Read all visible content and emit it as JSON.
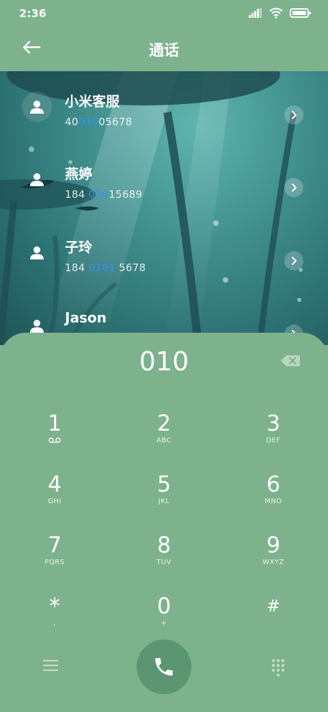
{
  "status": {
    "time": "2:36"
  },
  "header": {
    "title": "通话"
  },
  "contacts": [
    {
      "name": "小米客服",
      "num_pre": "40",
      "num_hl": "010",
      "num_post": "05678"
    },
    {
      "name": "燕婷",
      "num_pre": "184 ",
      "num_hl": "010",
      "num_post": "15689"
    },
    {
      "name": "子玲",
      "num_pre": "184 ",
      "num_hl": "0101",
      "num_post": " 5678"
    },
    {
      "name": "Jason",
      "num_pre": "",
      "num_hl": "",
      "num_post": ""
    }
  ],
  "dialer": {
    "input": "010",
    "keys": [
      {
        "digit": "1",
        "letters": ""
      },
      {
        "digit": "2",
        "letters": "ABC"
      },
      {
        "digit": "3",
        "letters": "DEF"
      },
      {
        "digit": "4",
        "letters": "GHI"
      },
      {
        "digit": "5",
        "letters": "JKL"
      },
      {
        "digit": "6",
        "letters": "MNO"
      },
      {
        "digit": "7",
        "letters": "PQRS"
      },
      {
        "digit": "8",
        "letters": "TUV"
      },
      {
        "digit": "9",
        "letters": "WXYZ"
      },
      {
        "digit": "*",
        "letters": ","
      },
      {
        "digit": "0",
        "letters": "+"
      },
      {
        "digit": "#",
        "letters": ""
      }
    ]
  },
  "icons": {
    "back": "back-arrow-icon",
    "voicemail": "voicemail-icon",
    "menu": "menu-icon",
    "call": "phone-icon",
    "dialpad": "dialpad-icon",
    "backspace": "backspace-icon"
  }
}
